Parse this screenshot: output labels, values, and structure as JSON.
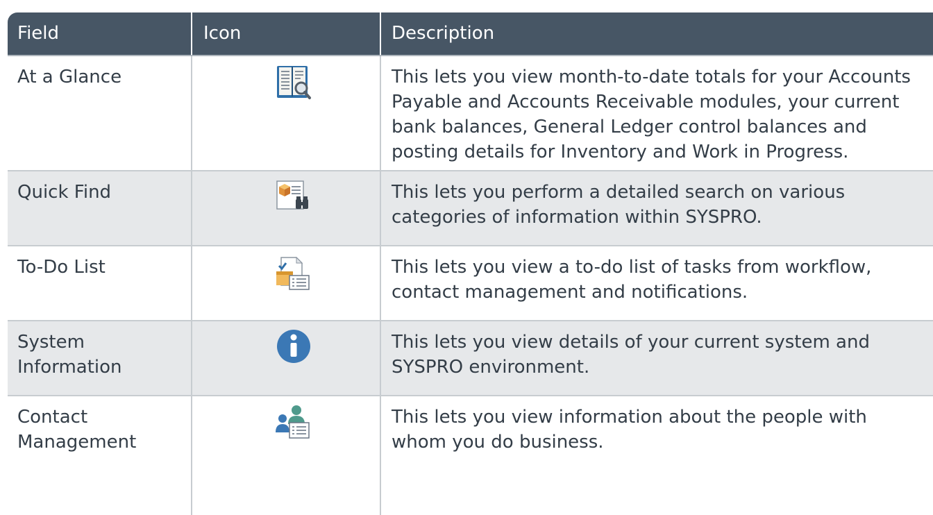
{
  "table": {
    "headers": {
      "field": "Field",
      "icon": "Icon",
      "description": "Description"
    },
    "rows": [
      {
        "field": "At a Glance",
        "icon": "book-magnifier-icon",
        "description": [
          "This lets you view month-to-date totals for your Accounts",
          "Payable and Accounts Receivable modules, your current",
          "bank balances, General Ledger control balances and",
          "posting details for Inventory and Work in Progress."
        ]
      },
      {
        "field": "Quick Find",
        "icon": "package-binoculars-icon",
        "description": [
          "This lets you perform a detailed search on various",
          "categories of information within SYSPRO."
        ]
      },
      {
        "field": "To-Do List",
        "icon": "document-list-icon",
        "description": [
          "This lets you view a to-do list of tasks from workflow,",
          "contact management and notifications."
        ]
      },
      {
        "field": "System Information",
        "field_lines": [
          "System",
          "Information"
        ],
        "icon": "info-icon",
        "description": [
          "This lets you view details of your current system and",
          "SYSPRO environment."
        ]
      },
      {
        "field": "Contact Management",
        "field_lines": [
          "Contact",
          "Management"
        ],
        "icon": "contacts-card-icon",
        "description": [
          "This lets you view information about the people with",
          "whom you do business."
        ]
      }
    ]
  },
  "colors": {
    "header_bg": "#475665",
    "header_text": "#ffffff",
    "row_alt_bg": "#e6e8ea",
    "body_text": "#333d47",
    "info_blue": "#3b78b5"
  }
}
